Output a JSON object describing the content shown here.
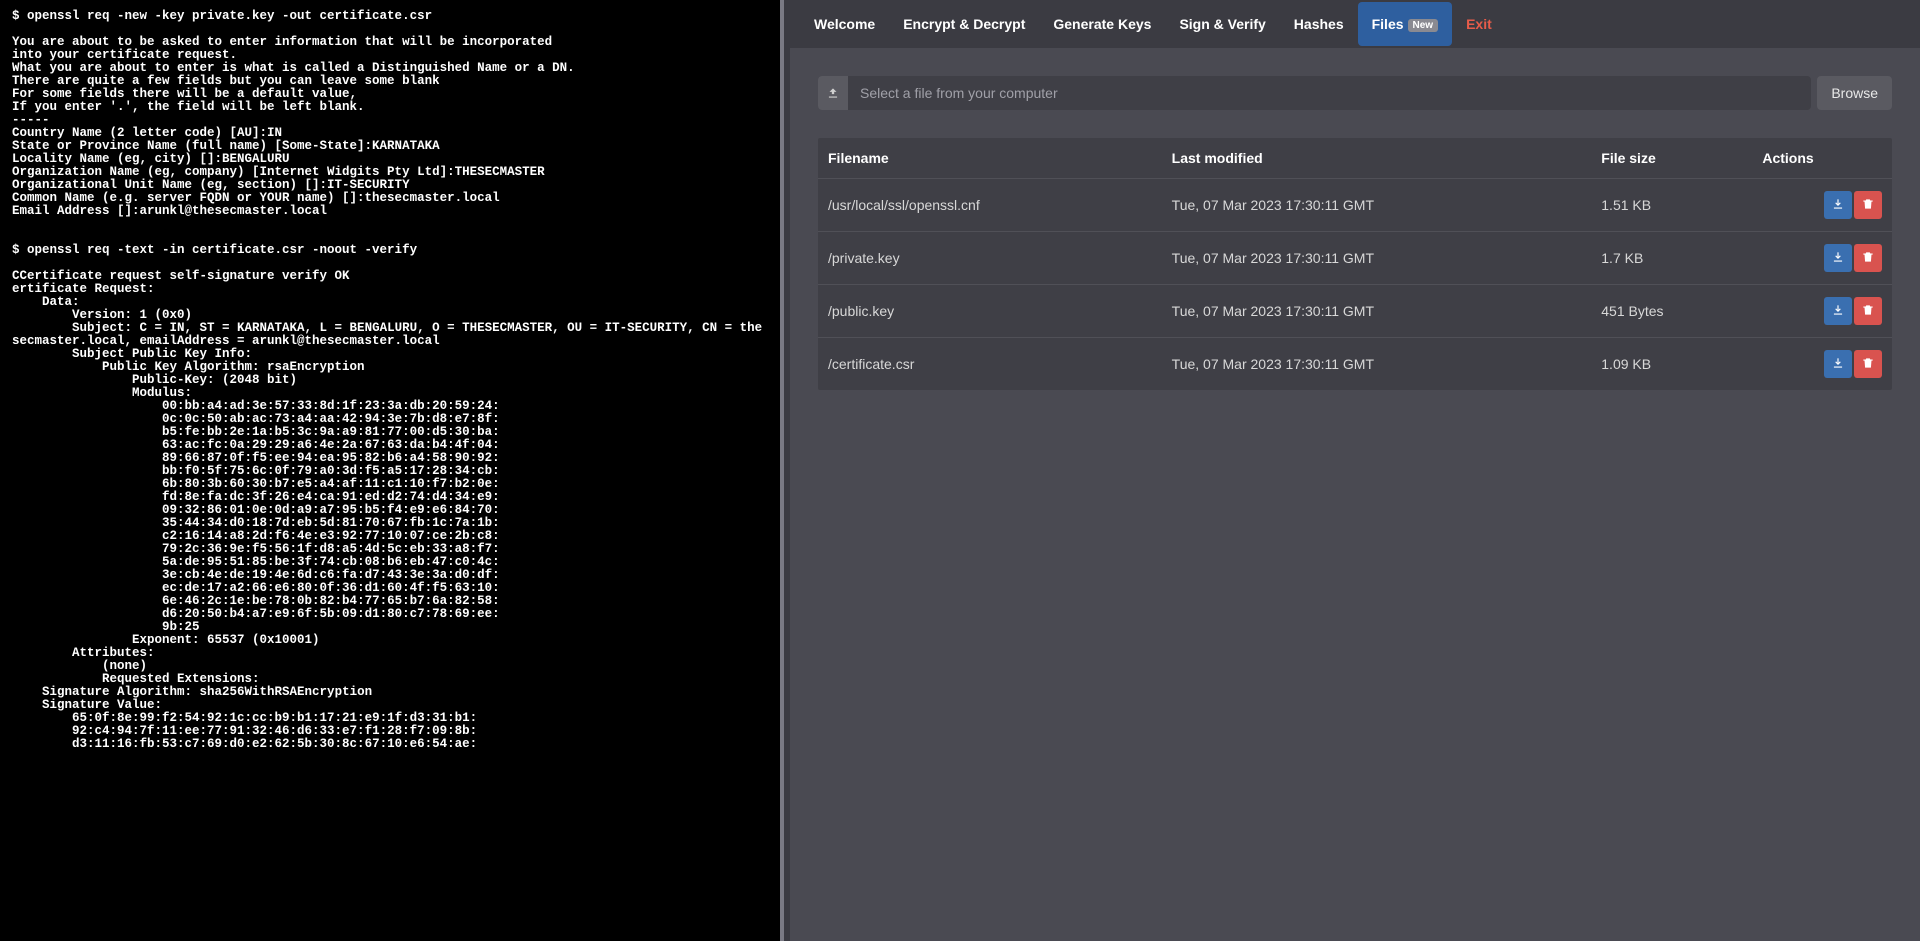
{
  "terminal_text": "$ openssl req -new -key private.key -out certificate.csr\n\nYou are about to be asked to enter information that will be incorporated\ninto your certificate request.\nWhat you are about to enter is what is called a Distinguished Name or a DN.\nThere are quite a few fields but you can leave some blank\nFor some fields there will be a default value,\nIf you enter '.', the field will be left blank.\n-----\nCountry Name (2 letter code) [AU]:IN\nState or Province Name (full name) [Some-State]:KARNATAKA\nLocality Name (eg, city) []:BENGALURU\nOrganization Name (eg, company) [Internet Widgits Pty Ltd]:THESECMASTER\nOrganizational Unit Name (eg, section) []:IT-SECURITY\nCommon Name (e.g. server FQDN or YOUR name) []:thesecmaster.local\nEmail Address []:arunkl@thesecmaster.local\n\n\n$ openssl req -text -in certificate.csr -noout -verify\n\nCCertificate request self-signature verify OK\nertificate Request:\n    Data:\n        Version: 1 (0x0)\n        Subject: C = IN, ST = KARNATAKA, L = BENGALURU, O = THESECMASTER, OU = IT-SECURITY, CN = thesecmaster.local, emailAddress = arunkl@thesecmaster.local\n        Subject Public Key Info:\n            Public Key Algorithm: rsaEncryption\n                Public-Key: (2048 bit)\n                Modulus:\n                    00:bb:a4:ad:3e:57:33:8d:1f:23:3a:db:20:59:24:\n                    0c:0c:50:ab:ac:73:a4:aa:42:94:3e:7b:d8:e7:8f:\n                    b5:fe:bb:2e:1a:b5:3c:9a:a9:81:77:00:d5:30:ba:\n                    63:ac:fc:0a:29:29:a6:4e:2a:67:63:da:b4:4f:04:\n                    89:66:87:0f:f5:ee:94:ea:95:82:b6:a4:58:90:92:\n                    bb:f0:5f:75:6c:0f:79:a0:3d:f5:a5:17:28:34:cb:\n                    6b:80:3b:60:30:b7:e5:a4:af:11:c1:10:f7:b2:0e:\n                    fd:8e:fa:dc:3f:26:e4:ca:91:ed:d2:74:d4:34:e9:\n                    09:32:86:01:0e:0d:a9:a7:95:b5:f4:e9:e6:84:70:\n                    35:44:34:d0:18:7d:eb:5d:81:70:67:fb:1c:7a:1b:\n                    c2:16:14:a8:2d:f6:4e:e3:92:77:10:07:ce:2b:c8:\n                    79:2c:36:9e:f5:56:1f:d8:a5:4d:5c:eb:33:a8:f7:\n                    5a:de:95:51:85:be:3f:74:cb:08:b6:eb:47:c0:4c:\n                    3e:cb:4e:de:19:4e:6d:c6:fa:d7:43:3e:3a:d0:df:\n                    ec:de:17:a2:66:e6:80:0f:36:d1:60:4f:f5:63:10:\n                    6e:46:2c:1e:be:78:0b:82:b4:77:65:b7:6a:82:58:\n                    d6:20:50:b4:a7:e9:6f:5b:09:d1:80:c7:78:69:ee:\n                    9b:25\n                Exponent: 65537 (0x10001)\n        Attributes:\n            (none)\n            Requested Extensions:\n    Signature Algorithm: sha256WithRSAEncryption\n    Signature Value:\n        65:0f:8e:99:f2:54:92:1c:cc:b9:b1:17:21:e9:1f:d3:31:b1:\n        92:c4:94:7f:11:ee:77:91:32:46:d6:33:e7:f1:28:f7:09:8b:\n        d3:11:16:fb:53:c7:69:d0:e2:62:5b:30:8c:67:10:e6:54:ae:",
  "nav": {
    "items": [
      {
        "label": "Welcome",
        "active": false,
        "exit": false,
        "badge": false
      },
      {
        "label": "Encrypt & Decrypt",
        "active": false,
        "exit": false,
        "badge": false
      },
      {
        "label": "Generate Keys",
        "active": false,
        "exit": false,
        "badge": false
      },
      {
        "label": "Sign & Verify",
        "active": false,
        "exit": false,
        "badge": false
      },
      {
        "label": "Hashes",
        "active": false,
        "exit": false,
        "badge": false
      },
      {
        "label": "Files",
        "active": true,
        "exit": false,
        "badge": true,
        "badge_text": "New"
      },
      {
        "label": "Exit",
        "active": false,
        "exit": true,
        "badge": false
      }
    ]
  },
  "file_input": {
    "placeholder": "Select a file from your computer",
    "browse_label": "Browse"
  },
  "table": {
    "headers": {
      "filename": "Filename",
      "modified": "Last modified",
      "size": "File size",
      "actions": "Actions"
    }
  },
  "files": [
    {
      "name": "/usr/local/ssl/openssl.cnf",
      "modified": "Tue, 07 Mar 2023 17:30:11 GMT",
      "size": "1.51 KB"
    },
    {
      "name": "/private.key",
      "modified": "Tue, 07 Mar 2023 17:30:11 GMT",
      "size": "1.7 KB"
    },
    {
      "name": "/public.key",
      "modified": "Tue, 07 Mar 2023 17:30:11 GMT",
      "size": "451 Bytes"
    },
    {
      "name": "/certificate.csr",
      "modified": "Tue, 07 Mar 2023 17:30:11 GMT",
      "size": "1.09 KB"
    }
  ]
}
